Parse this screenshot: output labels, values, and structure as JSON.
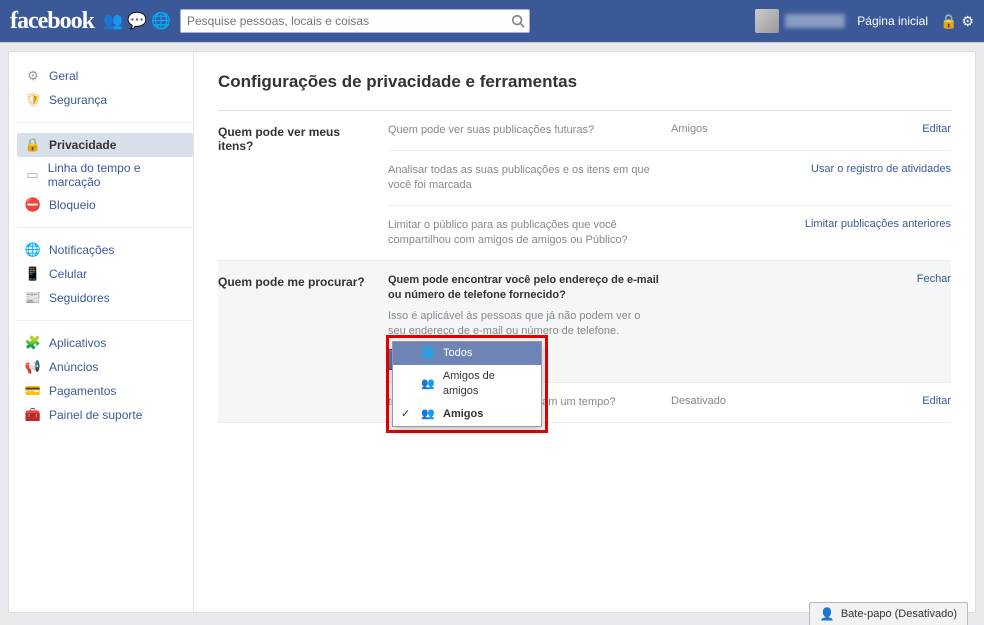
{
  "topbar": {
    "logo": "facebook",
    "search_placeholder": "Pesquise pessoas, locais e coisas",
    "home": "Página inicial"
  },
  "sidebar": {
    "groups": [
      {
        "items": [
          {
            "icon": "gear",
            "label": "Geral"
          },
          {
            "icon": "shield",
            "label": "Segurança"
          }
        ]
      },
      {
        "items": [
          {
            "icon": "lock",
            "label": "Privacidade",
            "active": true
          },
          {
            "icon": "timeline",
            "label": "Linha do tempo e marcação"
          },
          {
            "icon": "block",
            "label": "Bloqueio"
          }
        ]
      },
      {
        "items": [
          {
            "icon": "globe",
            "label": "Notificações"
          },
          {
            "icon": "phone",
            "label": "Celular"
          },
          {
            "icon": "followers",
            "label": "Seguidores"
          }
        ]
      },
      {
        "items": [
          {
            "icon": "apps",
            "label": "Aplicativos"
          },
          {
            "icon": "ads",
            "label": "Anúncios"
          },
          {
            "icon": "payments",
            "label": "Pagamentos"
          },
          {
            "icon": "support",
            "label": "Painel de suporte"
          }
        ]
      }
    ]
  },
  "page": {
    "title": "Configurações de privacidade e ferramentas"
  },
  "sections": {
    "see": {
      "header": "Quem pode ver meus itens?",
      "row1": {
        "desc": "Quem pode ver suas publicações futuras?",
        "value": "Amigos",
        "action": "Editar"
      },
      "row2": {
        "desc": "Analisar todas as suas publicações e os itens em que você foi marcada",
        "action": "Usar o registro de atividades"
      },
      "row3": {
        "desc": "Limitar o público para as publicações que você compartilhou com amigos de amigos ou Público?",
        "action": "Limitar publicações anteriores"
      }
    },
    "find": {
      "header": "Quem pode me procurar?",
      "row1": {
        "desc_main": "Quem pode encontrar você pelo endereço de e-mail ou número de telefone fornecido?",
        "desc_sub": "Isso é aplicável às pessoas que já não podem ver o seu endereço de e-mail ou número de telefone.",
        "button": "Amigos",
        "action": "Fechar"
      },
      "row2": {
        "desc": "tros mecanismos de busca exibam um tempo?",
        "value": "Desativado",
        "action": "Editar"
      }
    }
  },
  "dropdown": {
    "opt1": "Todos",
    "opt2": "Amigos de amigos",
    "opt3": "Amigos"
  },
  "chat": {
    "label": "Bate-papo (Desativado)"
  }
}
